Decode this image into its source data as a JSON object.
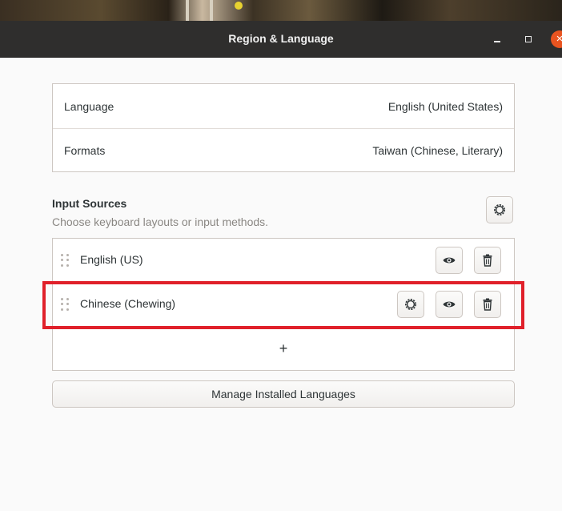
{
  "window": {
    "title": "Region & Language",
    "close_glyph": "×"
  },
  "language_settings": [
    {
      "label": "Language",
      "value": "English (United States)"
    },
    {
      "label": "Formats",
      "value": "Taiwan (Chinese, Literary)"
    }
  ],
  "input_sources": {
    "title": "Input Sources",
    "subtitle": "Choose keyboard layouts or input methods.",
    "items": [
      {
        "label": "English (US)"
      },
      {
        "label": "Chinese (Chewing)"
      }
    ],
    "add_glyph": "+"
  },
  "manage_button_label": "Manage Installed Languages",
  "colors": {
    "titlebar": "#2f2e2d",
    "close_button": "#e95420",
    "highlight": "#e0202a"
  },
  "icons": [
    "gear-icon",
    "eye-icon",
    "trash-icon",
    "drag-handle-icon",
    "add-icon",
    "minimize-icon",
    "maximize-icon",
    "close-icon"
  ]
}
